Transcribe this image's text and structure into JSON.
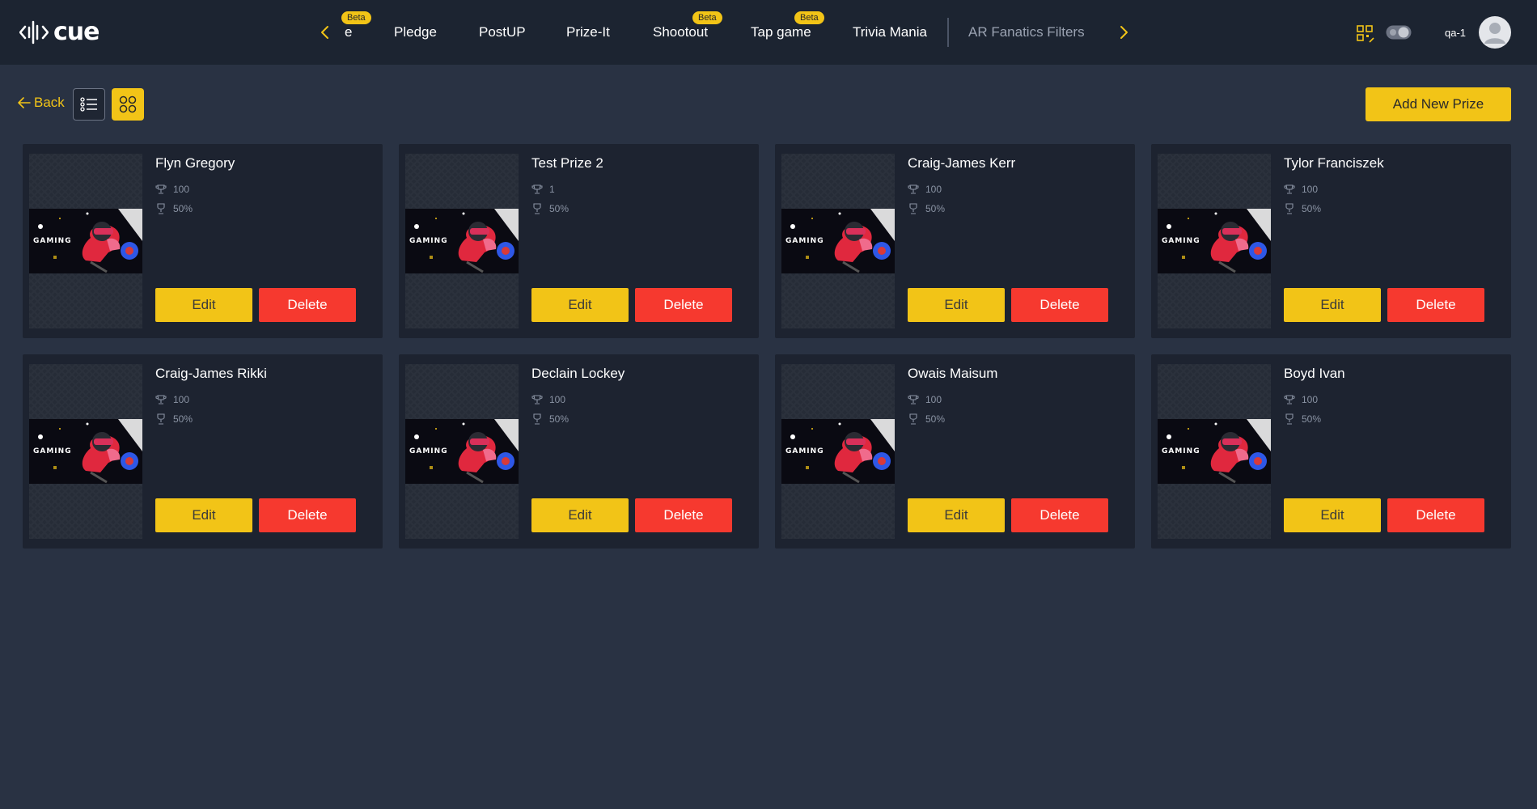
{
  "logo": {
    "text": "cue"
  },
  "nav": {
    "tabs": [
      {
        "label": "e",
        "beta": "Beta",
        "muted": false
      },
      {
        "label": "Pledge",
        "beta": "",
        "muted": false
      },
      {
        "label": "PostUP",
        "beta": "",
        "muted": false
      },
      {
        "label": "Prize-It",
        "beta": "",
        "muted": false
      },
      {
        "label": "Shootout",
        "beta": "Beta",
        "muted": false
      },
      {
        "label": "Tap game",
        "beta": "Beta",
        "muted": false
      },
      {
        "label": "Trivia Mania",
        "beta": "",
        "muted": false
      },
      {
        "label": "AR Fanatics Filters",
        "beta": "",
        "muted": true
      }
    ]
  },
  "user": {
    "name": "qa-1"
  },
  "toolbar": {
    "back_label": "Back",
    "add_label": "Add New Prize",
    "active_view": "grid"
  },
  "cards": [
    {
      "title": "Flyn Gregory",
      "quantity": "100",
      "percent": "50%",
      "thumb_text": "GAMING",
      "edit": "Edit",
      "delete": "Delete"
    },
    {
      "title": "Test Prize 2",
      "quantity": "1",
      "percent": "50%",
      "thumb_text": "GAMING",
      "edit": "Edit",
      "delete": "Delete"
    },
    {
      "title": "Craig-James Kerr",
      "quantity": "100",
      "percent": "50%",
      "thumb_text": "GAMING",
      "edit": "Edit",
      "delete": "Delete"
    },
    {
      "title": "Tylor Franciszek",
      "quantity": "100",
      "percent": "50%",
      "thumb_text": "GAMING",
      "edit": "Edit",
      "delete": "Delete"
    },
    {
      "title": "Craig-James Rikki",
      "quantity": "100",
      "percent": "50%",
      "thumb_text": "GAMING",
      "edit": "Edit",
      "delete": "Delete"
    },
    {
      "title": "Declain Lockey",
      "quantity": "100",
      "percent": "50%",
      "thumb_text": "GAMING",
      "edit": "Edit",
      "delete": "Delete"
    },
    {
      "title": "Owais Maisum",
      "quantity": "100",
      "percent": "50%",
      "thumb_text": "GAMING",
      "edit": "Edit",
      "delete": "Delete"
    },
    {
      "title": "Boyd Ivan",
      "quantity": "100",
      "percent": "50%",
      "thumb_text": "GAMING",
      "edit": "Edit",
      "delete": "Delete"
    }
  ],
  "colors": {
    "accent": "#f2c417",
    "danger": "#f6392f",
    "background": "#293243",
    "topbar": "#1c2431",
    "card": "#1d2330"
  }
}
